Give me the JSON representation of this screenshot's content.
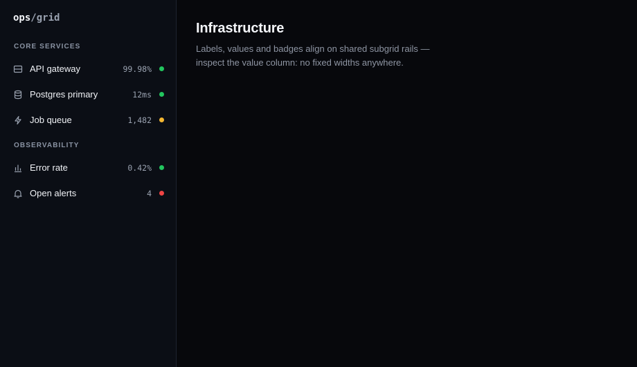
{
  "brand": {
    "primary": "ops",
    "slash": "/",
    "secondary": "grid"
  },
  "sections": [
    {
      "label": "CORE SERVICES",
      "items": [
        {
          "label": "API gateway",
          "value": "99.98%",
          "icon": "server-icon",
          "status": "#22c55e"
        },
        {
          "label": "Postgres primary",
          "value": "12ms",
          "icon": "database-icon",
          "status": "#22c55e"
        },
        {
          "label": "Job queue",
          "value": "1,482",
          "icon": "bolt-icon",
          "status": "#f5b731"
        }
      ]
    },
    {
      "label": "OBSERVABILITY",
      "items": [
        {
          "label": "Error rate",
          "value": "0.42%",
          "icon": "bar-chart-icon",
          "status": "#22c55e"
        },
        {
          "label": "Open alerts",
          "value": "4",
          "icon": "bell-icon",
          "status": "#ef4444"
        }
      ]
    }
  ],
  "main": {
    "title": "Infrastructure",
    "description": "Labels, values and badges align on shared subgrid rails — inspect the value column: no fixed widths anywhere."
  }
}
